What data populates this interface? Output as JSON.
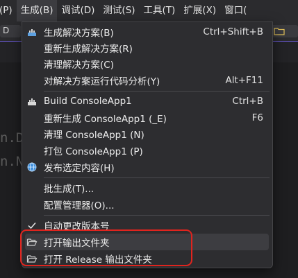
{
  "menubar": {
    "items": [
      "(P)",
      "生成(B)",
      "调试(D)",
      "测试(S)",
      "工具(T)",
      "扩展(X)",
      "窗口("
    ]
  },
  "toolbar": {
    "left_label": "D"
  },
  "editor": {
    "code_line_1": "n.D",
    "code_line_2": "n.N"
  },
  "build_menu": {
    "items": [
      {
        "label": "生成解决方案(B)",
        "shortcut": "Ctrl+Shift+B",
        "icon": "build-solution-icon"
      },
      {
        "label": "重新生成解决方案(R)",
        "shortcut": ""
      },
      {
        "label": "清理解决方案(C)",
        "shortcut": ""
      },
      {
        "label": "对解决方案运行代码分析(Y)",
        "shortcut": "Alt+F11"
      },
      {
        "label": "Build ConsoleApp1",
        "shortcut": "Ctrl+B",
        "icon": "build-project-icon"
      },
      {
        "label": "重新生成 ConsoleApp1 (_E)",
        "shortcut": "F6"
      },
      {
        "label": "清理 ConsoleApp1 (N)",
        "shortcut": ""
      },
      {
        "label": "打包 ConsoleApp1 (P)",
        "shortcut": ""
      },
      {
        "label": "发布选定内容(H)",
        "shortcut": "",
        "icon": "publish-globe-icon"
      },
      {
        "label": "批生成(T)...",
        "shortcut": ""
      },
      {
        "label": "配置管理器(O)...",
        "shortcut": ""
      },
      {
        "label": "自动更改版本号",
        "shortcut": "",
        "icon": "checkmark-icon"
      },
      {
        "label": "打开输出文件夹",
        "shortcut": "",
        "icon": "open-folder-icon"
      },
      {
        "label": "打开 Release 输出文件夹",
        "shortcut": "",
        "icon": "open-folder-icon"
      }
    ]
  },
  "colors": {
    "menu_bg": "#2d2d30",
    "highlight_border": "#e0241e",
    "accent_line": "#6b5bd6"
  }
}
